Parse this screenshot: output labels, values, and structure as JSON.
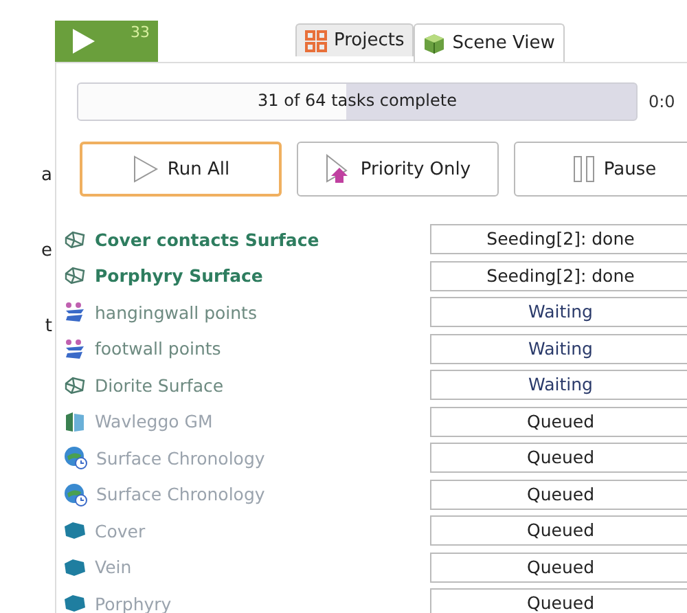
{
  "badge": {
    "count": "33"
  },
  "background_fragments": [
    "a",
    "e",
    "t"
  ],
  "tabs": [
    {
      "label": "Projects",
      "selected": false
    },
    {
      "label": "Scene View",
      "selected": true
    }
  ],
  "progress": {
    "text": "31 of 64 tasks complete",
    "level": 0.48,
    "time": "0:0"
  },
  "buttons": [
    {
      "label": "Run All",
      "focused": true
    },
    {
      "label": "Priority Only",
      "focused": false
    },
    {
      "label": "Pause",
      "focused": false
    }
  ],
  "tasks": [
    {
      "name": "Cover contacts Surface",
      "kind": "surface",
      "bold": true,
      "dimmed": false,
      "status": "Seeding[2]: done"
    },
    {
      "name": "Porphyry Surface",
      "kind": "surface",
      "bold": true,
      "dimmed": false,
      "status": "Seeding[2]: done"
    },
    {
      "name": "hangingwall points",
      "kind": "points",
      "bold": false,
      "dimmed": false,
      "status": "Waiting"
    },
    {
      "name": "footwall points",
      "kind": "points",
      "bold": false,
      "dimmed": false,
      "status": "Waiting"
    },
    {
      "name": "Diorite Surface",
      "kind": "surface",
      "bold": false,
      "dimmed": false,
      "status": "Waiting"
    },
    {
      "name": "Wavleggo GM",
      "kind": "model",
      "bold": false,
      "dimmed": true,
      "status": "Queued"
    },
    {
      "name": "Surface Chronology",
      "kind": "chronology",
      "bold": false,
      "dimmed": true,
      "status": "Queued"
    },
    {
      "name": "Surface Chronology",
      "kind": "chronology",
      "bold": false,
      "dimmed": true,
      "status": "Queued"
    },
    {
      "name": "Cover",
      "kind": "volume",
      "bold": false,
      "dimmed": true,
      "status": "Queued"
    },
    {
      "name": "Vein",
      "kind": "volume",
      "bold": false,
      "dimmed": true,
      "status": "Queued"
    },
    {
      "name": "Porphyry",
      "kind": "volume",
      "bold": false,
      "dimmed": true,
      "status": "Queued"
    }
  ]
}
